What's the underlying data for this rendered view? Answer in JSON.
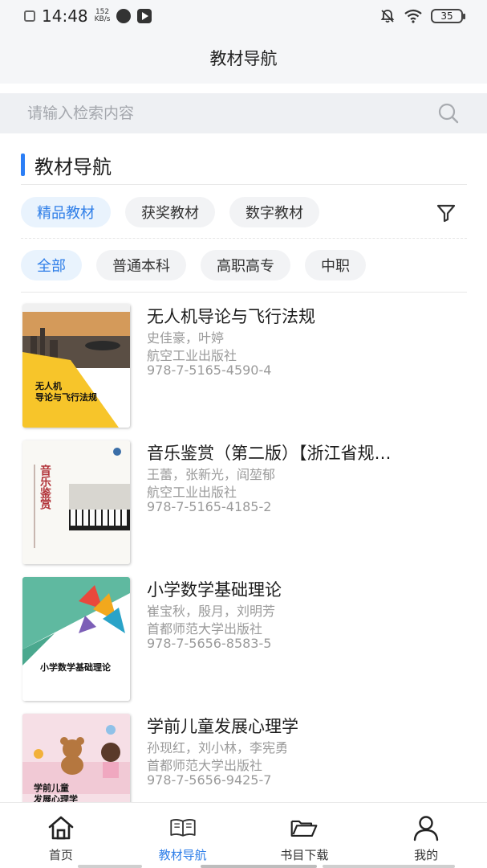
{
  "status": {
    "time": "14:48",
    "speed_value": "152",
    "speed_unit": "KB/s",
    "battery": "35"
  },
  "header": {
    "title": "教材导航"
  },
  "search": {
    "placeholder": "请输入检索内容"
  },
  "section": {
    "title": "教材导航"
  },
  "category_chips": [
    {
      "label": "精品教材",
      "active": true
    },
    {
      "label": "获奖教材",
      "active": false
    },
    {
      "label": "数字教材",
      "active": false
    }
  ],
  "level_chips": [
    {
      "label": "全部",
      "active": true
    },
    {
      "label": "普通本科",
      "active": false
    },
    {
      "label": "高职高专",
      "active": false
    },
    {
      "label": "中职",
      "active": false
    }
  ],
  "books": [
    {
      "title": "无人机导论与飞行法规",
      "authors": "史佳豪，叶婷",
      "publisher": "航空工业出版社",
      "isbn": "978-7-5165-4590-4",
      "cover_text": "无人机\n导论与飞行法规"
    },
    {
      "title": "音乐鉴赏（第二版）【浙江省规…",
      "authors": "王蕾，张新光，阎堃郁",
      "publisher": "航空工业出版社",
      "isbn": "978-7-5165-4185-2",
      "cover_text": "音乐鉴赏"
    },
    {
      "title": "小学数学基础理论",
      "authors": "崔宝秋，殷月，刘明芳",
      "publisher": "首都师范大学出版社",
      "isbn": "978-7-5656-8583-5",
      "cover_text": "小学数学基础理论"
    },
    {
      "title": "学前儿童发展心理学",
      "authors": "孙现红，刘小林，李宪勇",
      "publisher": "首都师范大学出版社",
      "isbn": "978-7-5656-9425-7",
      "cover_text": "学前儿童\n发展心理学"
    }
  ],
  "tabs": [
    {
      "label": "首页",
      "icon": "home-icon",
      "active": false
    },
    {
      "label": "教材导航",
      "icon": "book-icon",
      "active": true
    },
    {
      "label": "书目下载",
      "icon": "folder-icon",
      "active": false
    },
    {
      "label": "我的",
      "icon": "user-icon",
      "active": false
    }
  ],
  "colors": {
    "accent": "#2e7ee8",
    "accent_bar": "#2b7ef6",
    "chip_active_bg": "#e9f3fd",
    "chip_bg": "#f2f3f5"
  }
}
